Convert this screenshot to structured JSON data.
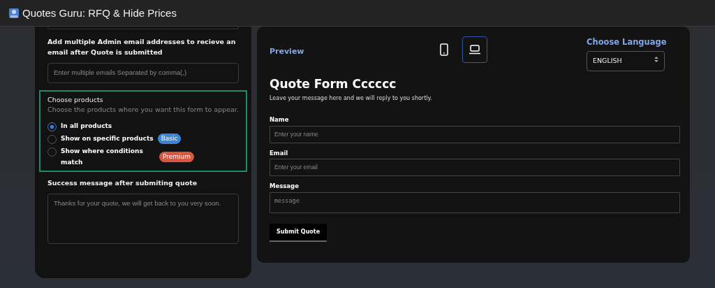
{
  "header": {
    "title": "Quotes Guru: RFQ & Hide Prices"
  },
  "settings": {
    "admin_emails": {
      "label": "Add multiple Admin email addresses to recieve an email after Quote is submitted",
      "placeholder": "Enter multiple emails Separated by comma(,)"
    },
    "products": {
      "title": "Choose products",
      "description": "Choose the products where you want this form to appear.",
      "options": [
        {
          "label": "In all products",
          "selected": true
        },
        {
          "label": "Show on specific products",
          "selected": false,
          "badge": {
            "label": "Basic",
            "color": "#3a86d6"
          }
        },
        {
          "label": "Show where conditions match",
          "selected": false,
          "badge": {
            "label": "Premium",
            "color": "#d9573f"
          }
        }
      ]
    },
    "success": {
      "label": "Success message after submiting quote",
      "placeholder": "Thanks for your quote, we will get back to you very soon."
    }
  },
  "preview": {
    "title": "Preview",
    "devices": [
      {
        "kind": "mobile",
        "selected": false
      },
      {
        "kind": "desktop",
        "selected": true
      }
    ],
    "language": {
      "label": "Choose Language",
      "value": "ENGLISH"
    },
    "form": {
      "title": "Quote Form Cccccc",
      "subtitle": "Leave your message here and we will reply to you shortly.",
      "fields": [
        {
          "kind": "input",
          "label": "Name",
          "placeholder": "Enter your name"
        },
        {
          "kind": "input",
          "label": "Email",
          "placeholder": "Enter your email"
        },
        {
          "kind": "textarea",
          "label": "Message",
          "placeholder": "message"
        }
      ],
      "submit": "Submit Quote"
    }
  }
}
